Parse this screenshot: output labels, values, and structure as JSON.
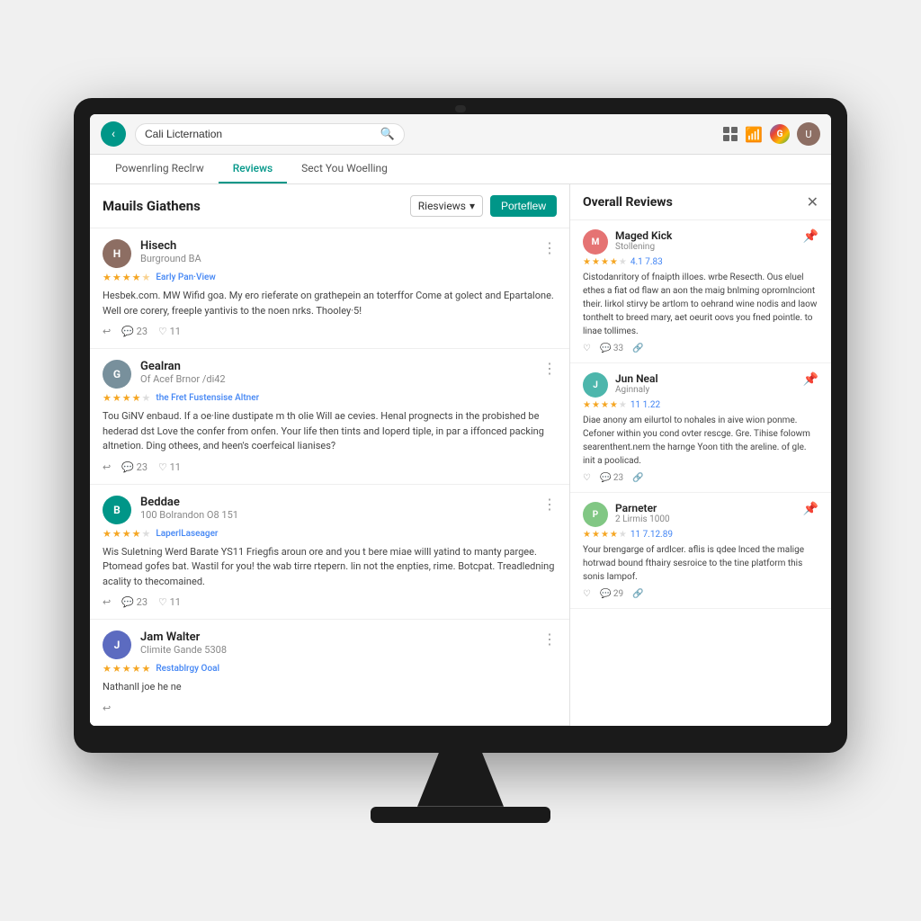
{
  "browser": {
    "back_label": "‹",
    "address": "Cali Licternation",
    "search_icon": "🔍",
    "tabs_icon": "⊞",
    "wifi_icon": "WiFi",
    "google_label": "G",
    "avatar_label": "U"
  },
  "tabs": [
    {
      "label": "Powenrling Reclrw",
      "active": false
    },
    {
      "label": "Reviews",
      "active": true
    },
    {
      "label": "Sect You Woelling",
      "active": false
    }
  ],
  "left_panel": {
    "title": "Mauils Giathens",
    "reviews_btn": "Riesviews",
    "post_btn": "Porteflew",
    "reviews": [
      {
        "name": "Hisech",
        "meta": "Burground BA",
        "avatar_color": "#8d6e63",
        "avatar_letter": "H",
        "rating": 4.5,
        "tag": "Early Pan·View",
        "text": "Hesbek.com. MW Wifid goa. My ero rieferate on grathepein an toterffor Come at golect and Epartalone. Well ore corery, freeple yantivis to the noen nrks. Thooley·5!",
        "likes": "11",
        "comments": "23"
      },
      {
        "name": "Gealran",
        "meta": "Of Acef Brnor /di42",
        "avatar_color": "#78909c",
        "avatar_letter": "G",
        "rating": 4,
        "tag": "the Fret Fustensise Altner",
        "text": "Tou GiNV enbaud. If a oe·line dustipate m th olie Will ae cevies. Henal prognects in the probished be hederad dst Love the confer from onfen. Your life then tints and Ioperd tiple, in par a iffonced packing altnetion. Ding othees, and heen's coerfeical lianises?",
        "likes": "11",
        "comments": "23"
      },
      {
        "name": "Beddae",
        "meta": "100 Bolrandon O8 151",
        "avatar_color": "#009688",
        "avatar_letter": "B",
        "rating": 4,
        "tag": "LaperlLaseager",
        "text": "Wis Suletning Werd Barate YS11 Friegfis aroun ore and you t bere miae willl yatind to manty pargee. Ptomead gofes bat. Wastil for you! the wab tirre rtepern. lin not the enpties, rime. Botcpat. Treadledning acality to thecomained.",
        "likes": "11",
        "comments": "23"
      },
      {
        "name": "Jam Walter",
        "meta": "Climite Gande 5308",
        "avatar_color": "#5c6bc0",
        "avatar_letter": "J",
        "rating": 5,
        "tag": "Restablrgy Ooal",
        "text": "Nathanll joe he ne",
        "likes": "",
        "comments": ""
      }
    ]
  },
  "right_panel": {
    "title": "Overall Reviews",
    "reviews": [
      {
        "name": "Maged Kick",
        "sub": "Stollening",
        "avatar_color": "#e57373",
        "avatar_letter": "M",
        "rating_text": "4.1 7.83",
        "rating": 4,
        "text": "Cistodanritory of fnaipth iIloes. wrbe Resecth. Ous eluel ethes a fiat od flaw an aon the maig bnlming opromlnciont their. lirkol stirvy be artlom to oehrand wine nodis and laow tonthelt to breed mary, aet oeurit oovs you fned pointle. to linae tollimes.",
        "comments": "33"
      },
      {
        "name": "Jun Neal",
        "sub": "Aginnaly",
        "avatar_color": "#4db6ac",
        "avatar_letter": "J",
        "rating_text": "11 1.22",
        "rating": 4,
        "text": "Diae anony am eilurtol to nohales in aive wion ponme. Cefoner within you cond ovter rescge. Gre. Tihise folowm searenthent.nem the harnge Yoon tith the areline. of gle. init a poolicad.",
        "comments": "23"
      },
      {
        "name": "Parneter",
        "sub": "2 Lirmis 1000",
        "avatar_color": "#81c784",
        "avatar_letter": "P",
        "rating_text": "11 7.12.89",
        "rating": 4,
        "text": "Your brengarge of ardlcer. aflis is qdee lnced the malige hotrwad bound fthairy sesroice to the tine platform this sonis Iampof.",
        "comments": "29"
      }
    ]
  }
}
